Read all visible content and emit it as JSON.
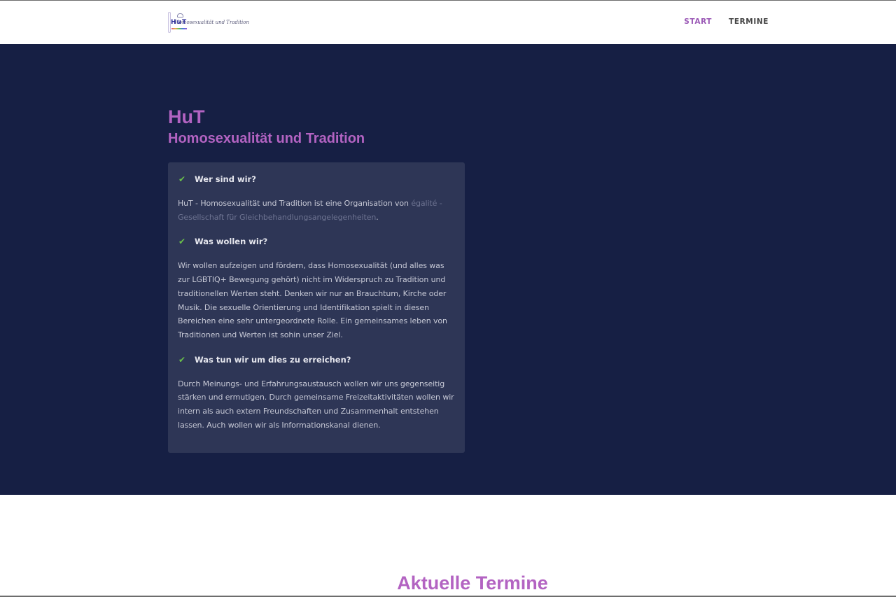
{
  "header": {
    "logo_text": "HuT",
    "logo_script": "Homosexualität und Tradition",
    "nav": [
      {
        "label": "START",
        "active": true
      },
      {
        "label": "TERMINE",
        "active": false
      }
    ]
  },
  "hero": {
    "title": "HuT",
    "subtitle": "Homosexualität und Tradition",
    "sections": [
      {
        "heading": "Wer sind wir?",
        "body_prefix": "HuT - Homosexualität und Tradition ist eine Organisation von ",
        "body_link": "égalité - Gesellschaft für Gleichbehandlungsangelegenheiten",
        "body_suffix": "."
      },
      {
        "heading": "Was wollen wir?",
        "body": "Wir wollen aufzeigen und fördern, dass Homosexualität (und alles was zur LGBTIQ+ Bewegung gehört) nicht im Widerspruch zu Tradition und traditionellen Werten steht. Denken wir nur an Brauchtum, Kirche oder Musik. Die sexuelle Orientierung und Identifikation spielt in diesen Bereichen eine sehr untergeordnete Rolle. Ein gemeinsames leben von Traditionen und Werten ist sohin unser Ziel."
      },
      {
        "heading": "Was tun wir um dies zu erreichen?",
        "body": "Durch Meinungs- und Erfahrungsaustausch wollen wir uns gegenseitig stärken und ermutigen. Durch gemeinsame Freizeitaktivitäten wollen wir intern als auch extern Freundschaften und Zusammenhalt entstehen lassen. Auch wollen wir als Informationskanal dienen."
      }
    ]
  },
  "termine": {
    "title": "Aktuelle Termine"
  },
  "colors": {
    "accent": "#b363c2",
    "hero_bg": "#161f44",
    "card_bg": "#2e3656",
    "check": "#6ac04a"
  }
}
